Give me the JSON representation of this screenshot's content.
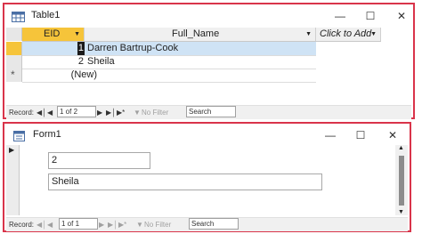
{
  "table_window": {
    "title": "Table1",
    "columns": [
      {
        "label": "EID"
      },
      {
        "label": "Full_Name"
      },
      {
        "label": "Click to Add"
      }
    ],
    "rows": [
      {
        "eid": "1",
        "full_name": "Darren Bartrup-Cook"
      },
      {
        "eid": "2",
        "full_name": "Sheila"
      }
    ],
    "new_row_label": "(New)",
    "new_row_marker": "*",
    "nav": {
      "record_label": "Record:",
      "position": "1 of 2",
      "filter": "No Filter",
      "search": "Search"
    },
    "colors": {
      "selected_row": "#cfe3f5",
      "header_accent": "#f6c43a"
    }
  },
  "form_window": {
    "title": "Form1",
    "eid_value": "2",
    "name_value": "Sheila",
    "nav": {
      "record_label": "Record:",
      "position": "1 of 1",
      "filter": "No Filter",
      "search": "Search"
    }
  }
}
